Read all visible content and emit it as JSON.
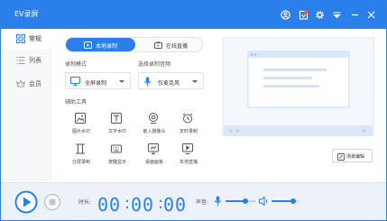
{
  "app": {
    "title": "EV录屏"
  },
  "titlebar": {
    "icons": [
      "user-icon",
      "vip-icon",
      "settings-icon",
      "menu-icon",
      "minimize-icon",
      "close-icon"
    ]
  },
  "sidebar": {
    "items": [
      {
        "label": "常规",
        "icon": "grid-icon",
        "active": true
      },
      {
        "label": "列表",
        "icon": "list-icon",
        "active": false
      },
      {
        "label": "会员",
        "icon": "crown-icon",
        "active": false
      }
    ]
  },
  "tabs": {
    "local": "本地录制",
    "live": "在线直播"
  },
  "record_mode": {
    "label": "录制模式",
    "value": "全屏录制"
  },
  "audio": {
    "label": "选择录制音频",
    "value": "仅麦克风"
  },
  "tools": {
    "label": "辅助工具",
    "items": [
      {
        "label": "图片水印",
        "icon": "image-icon"
      },
      {
        "label": "文字水印",
        "icon": "text-icon"
      },
      {
        "label": "嵌入摄像头",
        "icon": "camera-icon"
      },
      {
        "label": "定时录制",
        "icon": "alarm-icon"
      },
      {
        "label": "分屏录制",
        "icon": "split-screen-icon"
      },
      {
        "label": "按键显示",
        "icon": "keyboard-icon"
      },
      {
        "label": "桌面画板",
        "icon": "drawing-board-icon"
      },
      {
        "label": "本地直播",
        "icon": "local-live-icon"
      }
    ]
  },
  "scene": {
    "button": "场景编辑"
  },
  "footer": {
    "duration_label": "时长:",
    "time": {
      "h": "00",
      "m": "00",
      "s": "00"
    },
    "sound_label": "声音:",
    "mic_volume": 0.65,
    "speaker_volume": 0.8
  },
  "colors": {
    "accent": "#2a7fea",
    "preview_bg": "#e7f0fb"
  }
}
